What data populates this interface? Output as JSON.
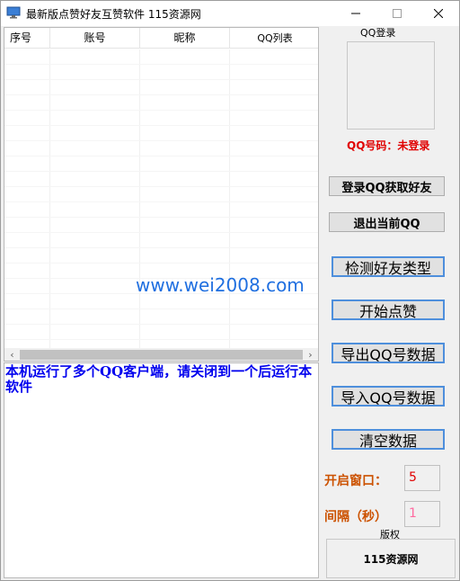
{
  "window": {
    "title": "最新版点赞好友互赞软件 115资源网",
    "minimize_icon": "minimize-icon",
    "maximize_icon": "maximize-icon",
    "close_icon": "close-icon"
  },
  "grid": {
    "columns": [
      "序号",
      "账号",
      "昵称",
      "QQ列表"
    ],
    "rows": []
  },
  "watermark": "www.wei2008.com",
  "log": {
    "message": "本机运行了多个QQ客户端，请关闭到一个后运行本软件"
  },
  "qq_panel": {
    "group_title": "QQ登录",
    "status": "QQ号码：未登录"
  },
  "buttons": {
    "login": "登录QQ获取好友",
    "logout": "退出当前QQ",
    "detect": "检测好友类型",
    "start_like": "开始点赞",
    "export": "导出QQ号数据",
    "import": "导入QQ号数据",
    "clear": "清空数据"
  },
  "settings": {
    "window_label": "开启窗口：",
    "window_value": "5",
    "interval_label": "间隔（秒）",
    "interval_value": "1"
  },
  "copyright": {
    "title": "版权",
    "text": "115资源网"
  },
  "colors": {
    "status_red": "#e00000",
    "log_blue": "#0000ee",
    "label_orange": "#cc5200",
    "button_border_blue": "#4e8fdc"
  }
}
